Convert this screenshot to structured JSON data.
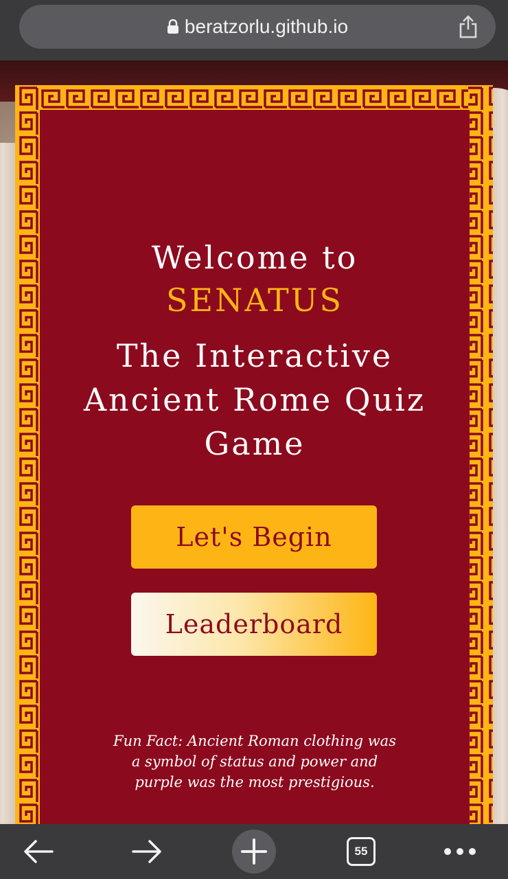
{
  "browser": {
    "url": "beratzorlu.github.io",
    "tab_count": "55"
  },
  "hero": {
    "welcome": "Welcome to",
    "brand": "SENATUS",
    "subtitle": "The Interactive Ancient Rome Quiz Game"
  },
  "buttons": {
    "begin": "Let's Begin",
    "leaderboard": "Leaderboard"
  },
  "fun_fact": "Fun Fact: Ancient Roman clothing was a symbol of status and power and purple was the most prestigious.",
  "colors": {
    "crimson": "#8c0a1e",
    "gold": "#fdb515",
    "toolbar": "#3a3a3c"
  },
  "icons": [
    "lock-icon",
    "share-icon",
    "back-arrow-icon",
    "forward-arrow-icon",
    "plus-icon",
    "tabs-icon",
    "more-icon"
  ]
}
